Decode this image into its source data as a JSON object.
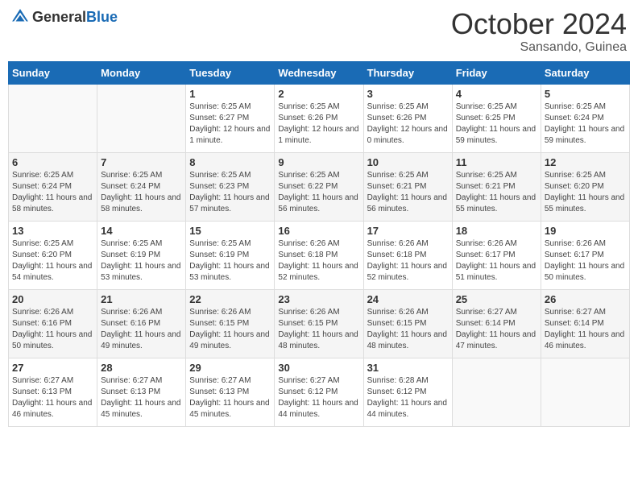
{
  "header": {
    "logo_general": "General",
    "logo_blue": "Blue",
    "month": "October 2024",
    "location": "Sansando, Guinea"
  },
  "weekdays": [
    "Sunday",
    "Monday",
    "Tuesday",
    "Wednesday",
    "Thursday",
    "Friday",
    "Saturday"
  ],
  "weeks": [
    [
      {
        "day": "",
        "sunrise": "",
        "sunset": "",
        "daylight": ""
      },
      {
        "day": "",
        "sunrise": "",
        "sunset": "",
        "daylight": ""
      },
      {
        "day": "1",
        "sunrise": "Sunrise: 6:25 AM",
        "sunset": "Sunset: 6:27 PM",
        "daylight": "Daylight: 12 hours and 1 minute."
      },
      {
        "day": "2",
        "sunrise": "Sunrise: 6:25 AM",
        "sunset": "Sunset: 6:26 PM",
        "daylight": "Daylight: 12 hours and 1 minute."
      },
      {
        "day": "3",
        "sunrise": "Sunrise: 6:25 AM",
        "sunset": "Sunset: 6:26 PM",
        "daylight": "Daylight: 12 hours and 0 minutes."
      },
      {
        "day": "4",
        "sunrise": "Sunrise: 6:25 AM",
        "sunset": "Sunset: 6:25 PM",
        "daylight": "Daylight: 11 hours and 59 minutes."
      },
      {
        "day": "5",
        "sunrise": "Sunrise: 6:25 AM",
        "sunset": "Sunset: 6:24 PM",
        "daylight": "Daylight: 11 hours and 59 minutes."
      }
    ],
    [
      {
        "day": "6",
        "sunrise": "Sunrise: 6:25 AM",
        "sunset": "Sunset: 6:24 PM",
        "daylight": "Daylight: 11 hours and 58 minutes."
      },
      {
        "day": "7",
        "sunrise": "Sunrise: 6:25 AM",
        "sunset": "Sunset: 6:24 PM",
        "daylight": "Daylight: 11 hours and 58 minutes."
      },
      {
        "day": "8",
        "sunrise": "Sunrise: 6:25 AM",
        "sunset": "Sunset: 6:23 PM",
        "daylight": "Daylight: 11 hours and 57 minutes."
      },
      {
        "day": "9",
        "sunrise": "Sunrise: 6:25 AM",
        "sunset": "Sunset: 6:22 PM",
        "daylight": "Daylight: 11 hours and 56 minutes."
      },
      {
        "day": "10",
        "sunrise": "Sunrise: 6:25 AM",
        "sunset": "Sunset: 6:21 PM",
        "daylight": "Daylight: 11 hours and 56 minutes."
      },
      {
        "day": "11",
        "sunrise": "Sunrise: 6:25 AM",
        "sunset": "Sunset: 6:21 PM",
        "daylight": "Daylight: 11 hours and 55 minutes."
      },
      {
        "day": "12",
        "sunrise": "Sunrise: 6:25 AM",
        "sunset": "Sunset: 6:20 PM",
        "daylight": "Daylight: 11 hours and 55 minutes."
      }
    ],
    [
      {
        "day": "13",
        "sunrise": "Sunrise: 6:25 AM",
        "sunset": "Sunset: 6:20 PM",
        "daylight": "Daylight: 11 hours and 54 minutes."
      },
      {
        "day": "14",
        "sunrise": "Sunrise: 6:25 AM",
        "sunset": "Sunset: 6:19 PM",
        "daylight": "Daylight: 11 hours and 53 minutes."
      },
      {
        "day": "15",
        "sunrise": "Sunrise: 6:25 AM",
        "sunset": "Sunset: 6:19 PM",
        "daylight": "Daylight: 11 hours and 53 minutes."
      },
      {
        "day": "16",
        "sunrise": "Sunrise: 6:26 AM",
        "sunset": "Sunset: 6:18 PM",
        "daylight": "Daylight: 11 hours and 52 minutes."
      },
      {
        "day": "17",
        "sunrise": "Sunrise: 6:26 AM",
        "sunset": "Sunset: 6:18 PM",
        "daylight": "Daylight: 11 hours and 52 minutes."
      },
      {
        "day": "18",
        "sunrise": "Sunrise: 6:26 AM",
        "sunset": "Sunset: 6:17 PM",
        "daylight": "Daylight: 11 hours and 51 minutes."
      },
      {
        "day": "19",
        "sunrise": "Sunrise: 6:26 AM",
        "sunset": "Sunset: 6:17 PM",
        "daylight": "Daylight: 11 hours and 50 minutes."
      }
    ],
    [
      {
        "day": "20",
        "sunrise": "Sunrise: 6:26 AM",
        "sunset": "Sunset: 6:16 PM",
        "daylight": "Daylight: 11 hours and 50 minutes."
      },
      {
        "day": "21",
        "sunrise": "Sunrise: 6:26 AM",
        "sunset": "Sunset: 6:16 PM",
        "daylight": "Daylight: 11 hours and 49 minutes."
      },
      {
        "day": "22",
        "sunrise": "Sunrise: 6:26 AM",
        "sunset": "Sunset: 6:15 PM",
        "daylight": "Daylight: 11 hours and 49 minutes."
      },
      {
        "day": "23",
        "sunrise": "Sunrise: 6:26 AM",
        "sunset": "Sunset: 6:15 PM",
        "daylight": "Daylight: 11 hours and 48 minutes."
      },
      {
        "day": "24",
        "sunrise": "Sunrise: 6:26 AM",
        "sunset": "Sunset: 6:15 PM",
        "daylight": "Daylight: 11 hours and 48 minutes."
      },
      {
        "day": "25",
        "sunrise": "Sunrise: 6:27 AM",
        "sunset": "Sunset: 6:14 PM",
        "daylight": "Daylight: 11 hours and 47 minutes."
      },
      {
        "day": "26",
        "sunrise": "Sunrise: 6:27 AM",
        "sunset": "Sunset: 6:14 PM",
        "daylight": "Daylight: 11 hours and 46 minutes."
      }
    ],
    [
      {
        "day": "27",
        "sunrise": "Sunrise: 6:27 AM",
        "sunset": "Sunset: 6:13 PM",
        "daylight": "Daylight: 11 hours and 46 minutes."
      },
      {
        "day": "28",
        "sunrise": "Sunrise: 6:27 AM",
        "sunset": "Sunset: 6:13 PM",
        "daylight": "Daylight: 11 hours and 45 minutes."
      },
      {
        "day": "29",
        "sunrise": "Sunrise: 6:27 AM",
        "sunset": "Sunset: 6:13 PM",
        "daylight": "Daylight: 11 hours and 45 minutes."
      },
      {
        "day": "30",
        "sunrise": "Sunrise: 6:27 AM",
        "sunset": "Sunset: 6:12 PM",
        "daylight": "Daylight: 11 hours and 44 minutes."
      },
      {
        "day": "31",
        "sunrise": "Sunrise: 6:28 AM",
        "sunset": "Sunset: 6:12 PM",
        "daylight": "Daylight: 11 hours and 44 minutes."
      },
      {
        "day": "",
        "sunrise": "",
        "sunset": "",
        "daylight": ""
      },
      {
        "day": "",
        "sunrise": "",
        "sunset": "",
        "daylight": ""
      }
    ]
  ]
}
